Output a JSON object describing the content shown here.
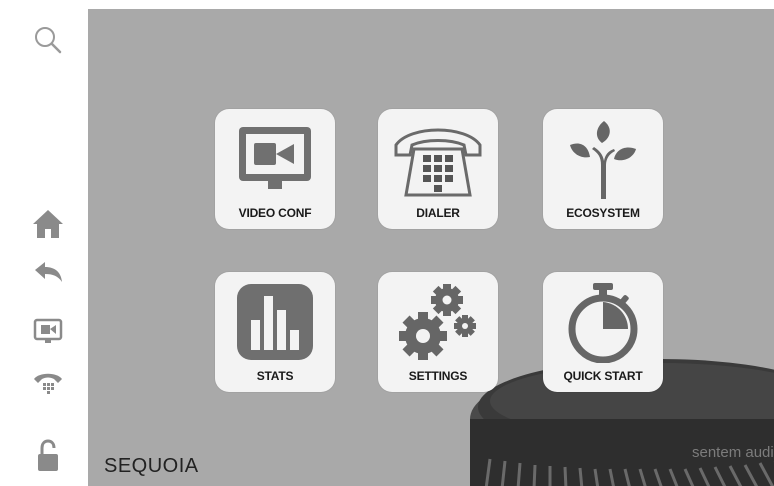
{
  "sidebar": {
    "icons": [
      "search-icon",
      "home-icon",
      "back-icon",
      "video-conf-icon",
      "phone-icon",
      "lock-icon"
    ]
  },
  "tiles": [
    {
      "label": "VIDEO CONF",
      "icon": "video-camera-monitor-icon"
    },
    {
      "label": "DIALER",
      "icon": "telephone-keypad-icon"
    },
    {
      "label": "ECOSYSTEM",
      "icon": "plant-sprout-icon"
    },
    {
      "label": "STATS",
      "icon": "bar-chart-icon"
    },
    {
      "label": "SETTINGS",
      "icon": "gears-icon"
    },
    {
      "label": "QUICK START",
      "icon": "stopwatch-icon"
    }
  ],
  "brand": {
    "name": "SEQUOIA"
  },
  "speaker": {
    "logo_text": "sentem audio"
  },
  "colors": {
    "background": "#a9a9a9",
    "tile": "#f3f3f3",
    "icon": "#6f6f6f",
    "icon_dark": "#555555"
  }
}
